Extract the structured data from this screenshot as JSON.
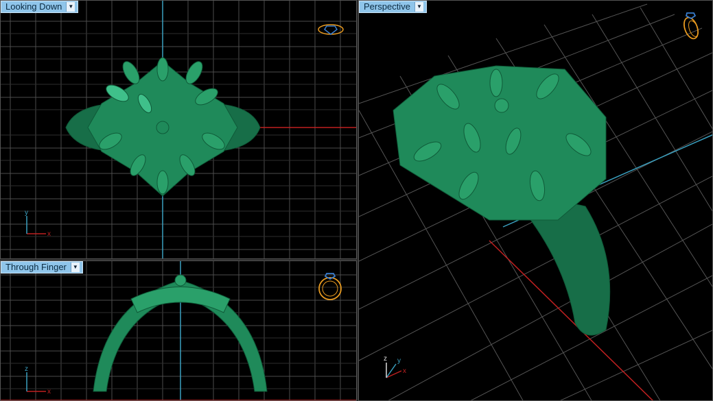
{
  "viewports": {
    "top": {
      "label": "Looking Down",
      "axis_x": "x",
      "axis_y": "y"
    },
    "front": {
      "label": "Through Finger",
      "axis_x": "x",
      "axis_y": "z"
    },
    "persp": {
      "label": "Perspective",
      "axis_x": "x",
      "axis_y": "y",
      "axis_z": "z"
    }
  },
  "icons": {
    "dropdown": "chevron-down-icon",
    "view_top": "ring-top-view-icon",
    "view_front": "ring-front-view-icon",
    "view_persp": "ring-perspective-view-icon"
  },
  "colors": {
    "background": "#000000",
    "grid": "#5a5a5a",
    "model": "#1f8a5a",
    "axis_x": "#c02020",
    "axis_y": "#3aa0c0",
    "label_bg": "#8fc5ea",
    "widget": "#e89a20"
  }
}
